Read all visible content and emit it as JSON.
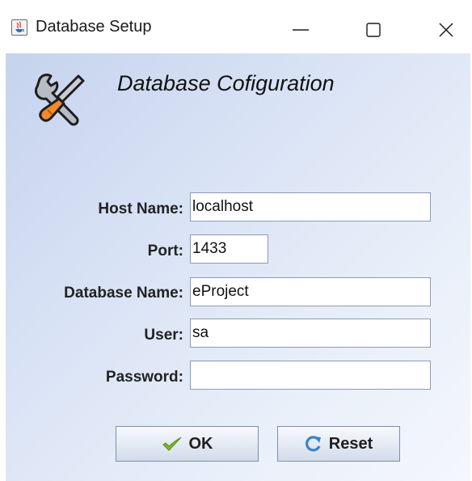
{
  "window": {
    "title": "Database Setup",
    "icon": "java-cup-icon",
    "controls": [
      "minimize-icon",
      "maximize-icon",
      "close-icon"
    ]
  },
  "header": {
    "icon": "tools-icon",
    "title": "Database Cofiguration"
  },
  "form": {
    "host": {
      "label": "Host Name:",
      "value": "localhost"
    },
    "port": {
      "label": "Port:",
      "value": "1433"
    },
    "database": {
      "label": "Database Name:",
      "value": "eProject"
    },
    "user": {
      "label": "User:",
      "value": "sa"
    },
    "password": {
      "label": "Password:",
      "value": ""
    }
  },
  "buttons": {
    "ok": {
      "label": "OK",
      "icon": "checkmark-icon"
    },
    "reset": {
      "label": "Reset",
      "icon": "refresh-icon"
    }
  },
  "colors": {
    "panel_gradient_start": "#c6d3ee",
    "panel_gradient_end": "#f4f7fc",
    "field_border": "#8a9bb8",
    "checkmark": "#7dbb2a",
    "refresh": "#3b82c8"
  }
}
